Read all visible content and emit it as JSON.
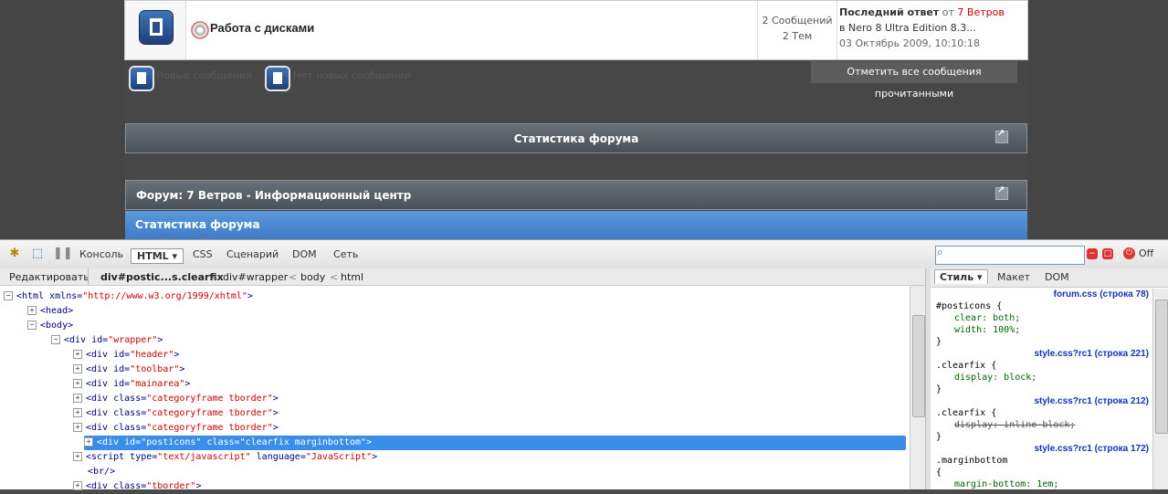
{
  "forum_row": {
    "title": "Работа с дисками",
    "messages": "2 Сообщений",
    "topics": "2 Тем",
    "last_reply_label": "Последний ответ",
    "last_reply_from": "от",
    "last_reply_author": "7 Ветров",
    "last_reply_in": "в Nero 8 Ultra Edition 8.3...",
    "last_reply_date": "03 Октябрь 2009, 10:10:18"
  },
  "legend": {
    "new_posts": "Новые сообщения",
    "no_new_posts": "Нет новых сообщений",
    "mark_read": "Отметить все сообщения прочитанными"
  },
  "sections": {
    "stats_header": "Статистика форума",
    "forum_header": "Форум: 7 Ветров - Информационный центр",
    "stats_subheader": "Статистика форума"
  },
  "firebug": {
    "tabs": [
      "Консоль",
      "HTML",
      "CSS",
      "Сценарий",
      "DOM",
      "Сеть"
    ],
    "active_tab": "HTML ▾",
    "off_label": "Off",
    "search_value": "",
    "breadcrumb": {
      "edit": "Редактировать",
      "items": [
        "div#postic...s.clearfix",
        "div#wrapper",
        "body",
        "html"
      ],
      "sep": "<"
    },
    "tree": [
      {
        "pm": "−",
        "open": "<html",
        "attrs": [
          [
            "xmlns",
            "http://www.w3.org/1999/xhtml"
          ]
        ],
        "close": ">"
      },
      {
        "pm": "+",
        "open": "<head>",
        "attrs": [],
        "close": ""
      },
      {
        "pm": "−",
        "open": "<body>",
        "attrs": [],
        "close": ""
      },
      {
        "pm": "−",
        "open": "<div",
        "attrs": [
          [
            "id",
            "wrapper"
          ]
        ],
        "close": ">"
      },
      {
        "pm": "+",
        "open": "<div",
        "attrs": [
          [
            "id",
            "header"
          ]
        ],
        "close": ">"
      },
      {
        "pm": "+",
        "open": "<div",
        "attrs": [
          [
            "id",
            "toolbar"
          ]
        ],
        "close": ">"
      },
      {
        "pm": "+",
        "open": "<div",
        "attrs": [
          [
            "id",
            "mainarea"
          ]
        ],
        "close": ">"
      },
      {
        "pm": "+",
        "open": "<div",
        "attrs": [
          [
            "class",
            "categoryframe tborder"
          ]
        ],
        "close": ">"
      },
      {
        "pm": "+",
        "open": "<div",
        "attrs": [
          [
            "class",
            "categoryframe tborder"
          ]
        ],
        "close": ">"
      },
      {
        "pm": "+",
        "open": "<div",
        "attrs": [
          [
            "class",
            "categoryframe tborder"
          ]
        ],
        "close": ">"
      },
      {
        "pm": "+",
        "open": "<div",
        "attrs": [
          [
            "id",
            "posticons"
          ],
          [
            "class",
            "clearfix marginbottom"
          ]
        ],
        "close": ">"
      },
      {
        "pm": "+",
        "open": "<script",
        "attrs": [
          [
            "type",
            "text/javascript"
          ],
          [
            "language",
            "JavaScript"
          ]
        ],
        "close": ">"
      },
      {
        "pm": "",
        "open": "<br/>",
        "attrs": [],
        "close": ""
      },
      {
        "pm": "+",
        "open": "<div",
        "attrs": [
          [
            "class",
            "tborder"
          ]
        ],
        "close": ">"
      }
    ],
    "side_tabs": [
      "Стиль ▾",
      "Макет",
      "DOM"
    ],
    "css_lines": [
      {
        "kind": "src",
        "text": "forum.css (строка 78)"
      },
      {
        "kind": "sel",
        "text": "#posticons {"
      },
      {
        "kind": "prop",
        "name": "clear",
        "value": "both;"
      },
      {
        "kind": "prop",
        "name": "width",
        "value": "100%;"
      },
      {
        "kind": "close",
        "text": "}"
      },
      {
        "kind": "src",
        "text": "style.css?rc1 (строка 221)"
      },
      {
        "kind": "sel",
        "text": ".clearfix {"
      },
      {
        "kind": "prop",
        "name": "display",
        "value": "block;"
      },
      {
        "kind": "close",
        "text": "}"
      },
      {
        "kind": "src",
        "text": "style.css?rc1 (строка 212)"
      },
      {
        "kind": "sel",
        "text": ".clearfix {"
      },
      {
        "kind": "strike",
        "name": "display",
        "value": "inline-block;"
      },
      {
        "kind": "close",
        "text": "}"
      },
      {
        "kind": "src",
        "text": "style.css?rc1 (строка 172)"
      },
      {
        "kind": "sel",
        "text": ".marginbottom"
      },
      {
        "kind": "sel",
        "text": "{"
      },
      {
        "kind": "prop",
        "name": "margin-bottom",
        "value": "1em;"
      }
    ]
  }
}
